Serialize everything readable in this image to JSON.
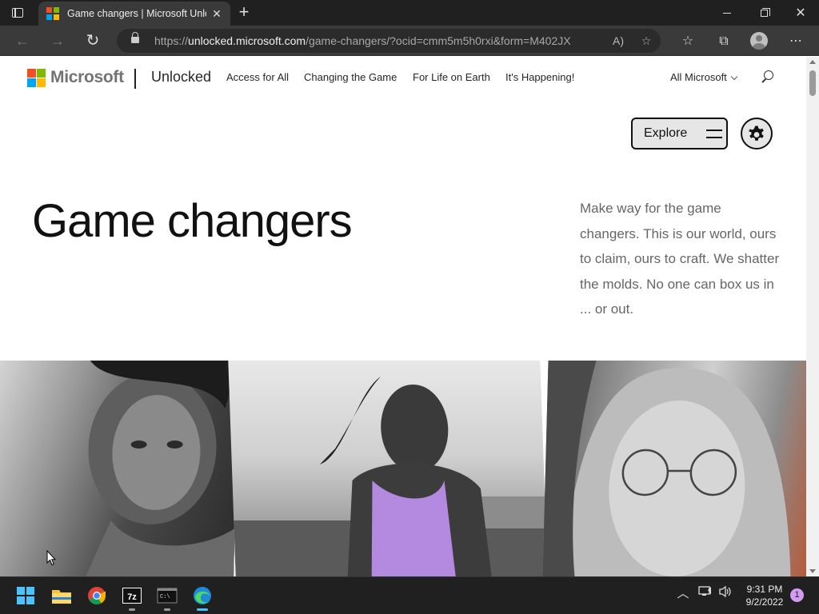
{
  "browser": {
    "tab_title": "Game changers | Microsoft Unlocked",
    "tab_close": "✕",
    "new_tab": "+",
    "url_prefix": "https://",
    "url_host": "unlocked.microsoft.com",
    "url_path": "/game-changers/?ocid=cmm5m5h0rxi&form=M402JX"
  },
  "site": {
    "brand": "Microsoft",
    "site_name": "Unlocked",
    "nav": [
      "Access for All",
      "Changing the Game",
      "For Life on Earth",
      "It's Happening!"
    ],
    "all_microsoft": "All Microsoft",
    "explore_label": "Explore"
  },
  "hero": {
    "title": "Game changers",
    "text": "Make way for the game changers. This is our world, ours to claim, ours to craft. We shatter the molds. No one can box us in ... or out."
  },
  "taskbar": {
    "time": "9:31 PM",
    "date": "9/2/2022",
    "notification_count": "1"
  },
  "colors": {
    "ms_red": "#f25022",
    "ms_green": "#7fba00",
    "ms_blue": "#00a4ef",
    "ms_yellow": "#ffb900",
    "edge_blue": "#4cc2ff"
  }
}
